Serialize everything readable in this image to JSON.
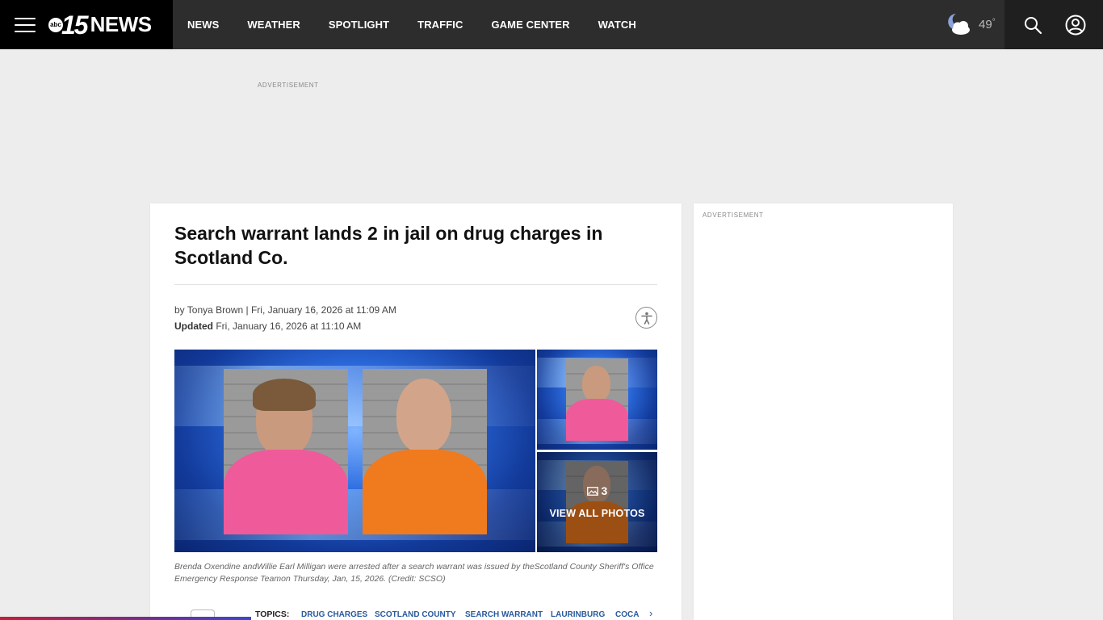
{
  "header": {
    "logo_abc": "abc",
    "logo_number": "15",
    "logo_text": "NEWS",
    "nav": [
      "NEWS",
      "WEATHER",
      "SPOTLIGHT",
      "TRAFFIC",
      "GAME CENTER",
      "WATCH"
    ],
    "weather_icon": "partly-cloudy-night-icon",
    "temperature": "49",
    "temperature_unit": "°"
  },
  "ads": {
    "top_label": "ADVERTISEMENT",
    "side_label": "ADVERTISEMENT"
  },
  "article": {
    "headline": "Search warrant lands 2 in jail on drug charges in Scotland Co.",
    "byline_prefix": "by ",
    "author": "Tonya Brown",
    "published": " | Fri, January 16, 2026 at 11:09 AM",
    "updated_label": "Updated",
    "updated": " Fri, January 16, 2026 at 11:10 AM",
    "gallery": {
      "photo_count": "3",
      "view_all_label": "VIEW ALL PHOTOS"
    },
    "caption": "Brenda Oxendine andWillie Earl Milligan were arrested after a search warrant was issued by theScotland County Sheriff's Office Emergency Response Teamon Thursday, Jan, 15, 2026. (Credit: SCSO)",
    "topics_label": "TOPICS:",
    "topics": [
      "DRUG CHARGES",
      "SCOTLAND COUNTY",
      "SEARCH WARRANT",
      "LAURINBURG",
      "COCA"
    ]
  },
  "colors": {
    "header_bg": "#2d2d2d",
    "brand_bg": "#000000",
    "topic_link": "#2a5a9c",
    "page_bg": "#ededed"
  }
}
